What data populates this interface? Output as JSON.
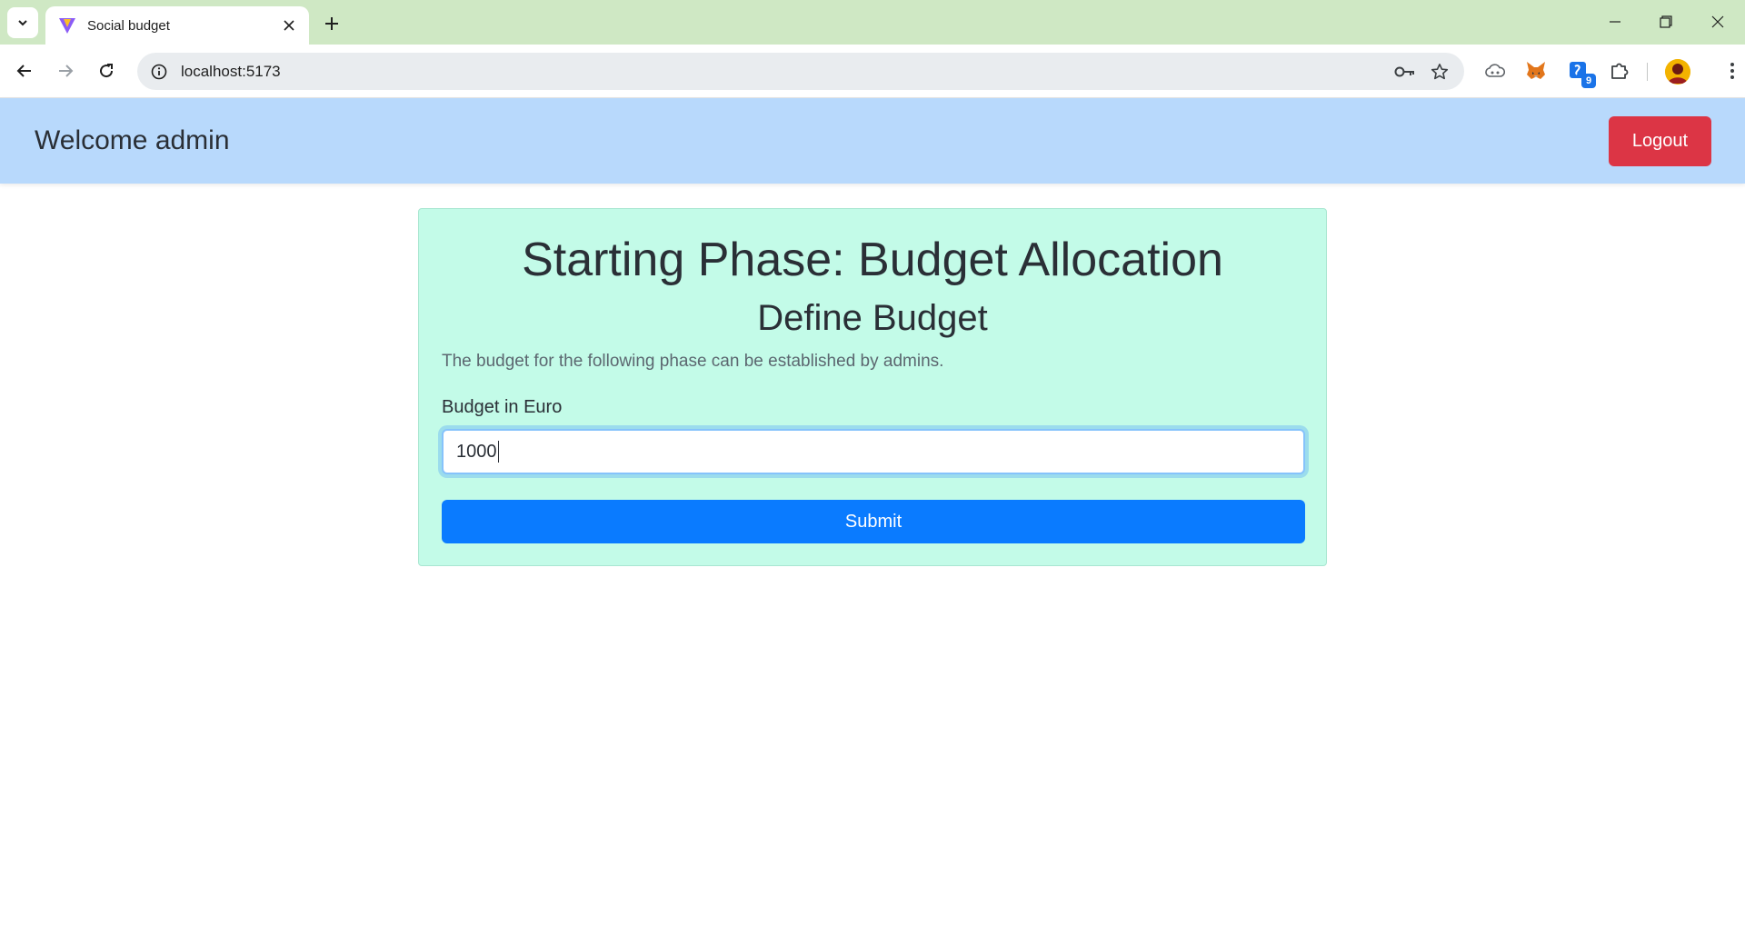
{
  "browser": {
    "tab_title": "Social budget",
    "url": "localhost:5173",
    "extension_badge": "9"
  },
  "app": {
    "welcome_text": "Welcome admin",
    "logout_label": "Logout"
  },
  "phase": {
    "title": "Starting Phase: Budget Allocation",
    "subtitle": "Define Budget",
    "description": "The budget for the following phase can be established by admins.",
    "budget_label": "Budget in Euro",
    "budget_value": "1000",
    "submit_label": "Submit"
  },
  "colors": {
    "navbar_bg": "#b8d9fc",
    "logout_bg": "#dc3545",
    "card_bg": "#c3fbe8",
    "submit_bg": "#0a7bff"
  }
}
